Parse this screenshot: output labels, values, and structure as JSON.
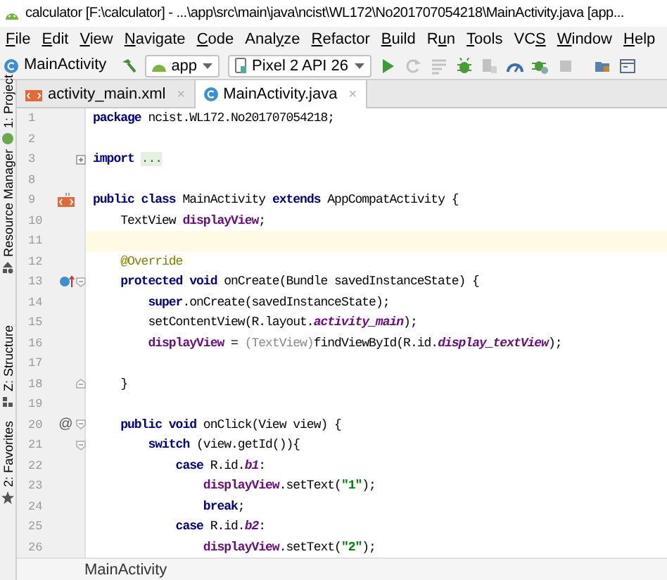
{
  "window": {
    "title": "calculator [F:\\calculator] - ...\\app\\src\\main\\java\\ncist\\WL172\\No201707054218\\MainActivity.java [app..."
  },
  "menu": [
    {
      "key": "F",
      "after": "ile"
    },
    {
      "key": "E",
      "after": "dit"
    },
    {
      "key": "V",
      "after": "iew"
    },
    {
      "key": "N",
      "after": "avigate"
    },
    {
      "key": "C",
      "after": "ode"
    },
    {
      "before": "Anal",
      "key": "y",
      "after": "ze"
    },
    {
      "key": "R",
      "after": "efactor"
    },
    {
      "key": "B",
      "after": "uild"
    },
    {
      "before": "R",
      "key": "u",
      "after": "n"
    },
    {
      "key": "T",
      "after": "ools"
    },
    {
      "before": "VC",
      "key": "S"
    },
    {
      "key": "W",
      "after": "indow"
    },
    {
      "key": "H",
      "after": "elp"
    }
  ],
  "toolbar": {
    "breadcrumb": "MainActivity",
    "targets": [
      {
        "kind": "module",
        "label": "app"
      },
      {
        "kind": "device",
        "label": "Pixel 2 API 26"
      }
    ],
    "buttons": [
      {
        "kind": "run",
        "disabled": false
      },
      {
        "kind": "rerun",
        "disabled": true
      },
      {
        "kind": "list",
        "disabled": true
      },
      {
        "kind": "debug",
        "disabled": false
      },
      {
        "kind": "attach",
        "disabled": true
      },
      {
        "kind": "profile",
        "disabled": false
      },
      {
        "kind": "debugattach",
        "disabled": false
      },
      {
        "kind": "stop",
        "disabled": true
      },
      {
        "kind": "folder",
        "disabled": false
      },
      {
        "kind": "window",
        "disabled": false
      }
    ]
  },
  "tabs": [
    {
      "kind": "xml",
      "label": "activity_main.xml",
      "close": "×",
      "selected": false
    },
    {
      "kind": "class",
      "label": "MainActivity.java",
      "close": "×",
      "selected": true
    }
  ],
  "side_tools": [
    {
      "kind": "project",
      "label": "1: Project"
    },
    {
      "kind": "resource",
      "label": "Resource Manager"
    },
    {
      "kind": "structure",
      "label": "Z: Structure"
    },
    {
      "kind": "favorites",
      "label": "2: Favorites"
    }
  ],
  "editor": {
    "lines": [
      {
        "number": "1",
        "kind": "code",
        "current": false,
        "fold_start": false,
        "fold_end": false,
        "collapsed": false,
        "tokens": [
          {
            "kind": "keyword",
            "text": "package"
          },
          {
            "kind": "plain",
            "text": " ncist.WL172.No201707054218;"
          }
        ]
      },
      {
        "number": "2",
        "kind": "code",
        "current": false,
        "fold_start": false,
        "fold_end": false,
        "collapsed": false
      },
      {
        "number": "3",
        "kind": "code",
        "current": false,
        "fold_start": false,
        "fold_end": false,
        "collapsed": true,
        "tokens": [
          {
            "kind": "keyword",
            "text": "import "
          },
          {
            "kind": "folded",
            "text": "..."
          }
        ]
      },
      {
        "number": "8",
        "kind": "code",
        "current": false,
        "fold_start": false,
        "fold_end": false,
        "collapsed": false
      },
      {
        "number": "9",
        "kind": "layout",
        "current": false,
        "fold_start": false,
        "fold_end": false,
        "collapsed": false,
        "tokens": [
          {
            "kind": "keyword",
            "text": "public class"
          },
          {
            "kind": "plain",
            "text": " MainActivity "
          },
          {
            "kind": "keyword",
            "text": "extends"
          },
          {
            "kind": "plain",
            "text": " AppCompatActivity {"
          }
        ]
      },
      {
        "number": "10",
        "kind": "code",
        "current": false,
        "fold_start": false,
        "fold_end": false,
        "collapsed": false,
        "tokens": [
          {
            "kind": "plain",
            "text": "    TextView "
          },
          {
            "kind": "field",
            "text": "displayView"
          },
          {
            "kind": "plain",
            "text": ";"
          }
        ]
      },
      {
        "number": "11",
        "kind": "code",
        "current": true,
        "fold_start": false,
        "fold_end": false,
        "collapsed": false
      },
      {
        "number": "12",
        "kind": "code",
        "current": false,
        "fold_start": false,
        "fold_end": false,
        "collapsed": false,
        "tokens": [
          {
            "kind": "annotation",
            "text": "    @Override"
          }
        ]
      },
      {
        "number": "13",
        "kind": "override",
        "current": false,
        "fold_start": true,
        "fold_end": false,
        "collapsed": false,
        "tokens": [
          {
            "kind": "keyword",
            "text": "    protected void"
          },
          {
            "kind": "plain",
            "text": " onCreate(Bundle savedInstanceState) {"
          }
        ]
      },
      {
        "number": "14",
        "kind": "code",
        "current": false,
        "fold_start": false,
        "fold_end": false,
        "collapsed": false,
        "tokens": [
          {
            "kind": "keyword",
            "text": "        super"
          },
          {
            "kind": "plain",
            "text": ".onCreate(savedInstanceState);"
          }
        ]
      },
      {
        "number": "15",
        "kind": "code",
        "current": false,
        "fold_start": false,
        "fold_end": false,
        "collapsed": false,
        "tokens": [
          {
            "kind": "plain",
            "text": "        setContentView(R.layout."
          },
          {
            "kind": "static",
            "text": "activity_main"
          },
          {
            "kind": "plain",
            "text": ");"
          }
        ]
      },
      {
        "number": "16",
        "kind": "code",
        "current": false,
        "fold_start": false,
        "fold_end": false,
        "collapsed": false,
        "tokens": [
          {
            "kind": "field",
            "text": "        displayView"
          },
          {
            "kind": "plain",
            "text": " = "
          },
          {
            "kind": "cast",
            "text": "(TextView)"
          },
          {
            "kind": "plain",
            "text": "findViewById(R.id."
          },
          {
            "kind": "static",
            "text": "display_textView"
          },
          {
            "kind": "plain",
            "text": ");"
          }
        ]
      },
      {
        "number": "17",
        "kind": "code",
        "current": false,
        "fold_start": false,
        "fold_end": false,
        "collapsed": false
      },
      {
        "number": "18",
        "kind": "code",
        "current": false,
        "fold_start": false,
        "fold_end": true,
        "collapsed": false,
        "tokens": [
          {
            "kind": "plain",
            "text": "    }"
          }
        ]
      },
      {
        "number": "19",
        "kind": "code",
        "current": false,
        "fold_start": false,
        "fold_end": false,
        "collapsed": false
      },
      {
        "number": "20",
        "kind": "code",
        "gutter_text": "@",
        "current": false,
        "fold_start": true,
        "fold_end": false,
        "collapsed": false,
        "tokens": [
          {
            "kind": "keyword",
            "text": "    public void"
          },
          {
            "kind": "plain",
            "text": " onClick(View view) {"
          }
        ]
      },
      {
        "number": "21",
        "kind": "code",
        "current": false,
        "fold_start": true,
        "fold_end": false,
        "collapsed": false,
        "tokens": [
          {
            "kind": "keyword",
            "text": "        switch"
          },
          {
            "kind": "plain",
            "text": " (view.getId()){"
          }
        ]
      },
      {
        "number": "22",
        "kind": "code",
        "current": false,
        "fold_start": false,
        "fold_end": false,
        "collapsed": false,
        "tokens": [
          {
            "kind": "keyword",
            "text": "            case"
          },
          {
            "kind": "plain",
            "text": " R.id."
          },
          {
            "kind": "static",
            "text": "b1"
          },
          {
            "kind": "plain",
            "text": ":"
          }
        ]
      },
      {
        "number": "23",
        "kind": "code",
        "current": false,
        "fold_start": false,
        "fold_end": false,
        "collapsed": false,
        "tokens": [
          {
            "kind": "field",
            "text": "                displayView"
          },
          {
            "kind": "plain",
            "text": ".setText("
          },
          {
            "kind": "string",
            "text": "\"1\""
          },
          {
            "kind": "plain",
            "text": ");"
          }
        ]
      },
      {
        "number": "24",
        "kind": "code",
        "current": false,
        "fold_start": false,
        "fold_end": false,
        "collapsed": false,
        "tokens": [
          {
            "kind": "keyword",
            "text": "                break"
          },
          {
            "kind": "plain",
            "text": ";"
          }
        ]
      },
      {
        "number": "25",
        "kind": "code",
        "current": false,
        "fold_start": false,
        "fold_end": false,
        "collapsed": false,
        "tokens": [
          {
            "kind": "keyword",
            "text": "            case"
          },
          {
            "kind": "plain",
            "text": " R.id."
          },
          {
            "kind": "static",
            "text": "b2"
          },
          {
            "kind": "plain",
            "text": ":"
          }
        ]
      },
      {
        "number": "26",
        "kind": "code",
        "current": false,
        "fold_start": false,
        "fold_end": false,
        "collapsed": false,
        "tokens": [
          {
            "kind": "field",
            "text": "                displayView"
          },
          {
            "kind": "plain",
            "text": ".setText("
          },
          {
            "kind": "string",
            "text": "\"2\""
          },
          {
            "kind": "plain",
            "text": ");"
          }
        ]
      }
    ]
  },
  "status": {
    "breadcrumb": "MainActivity"
  }
}
